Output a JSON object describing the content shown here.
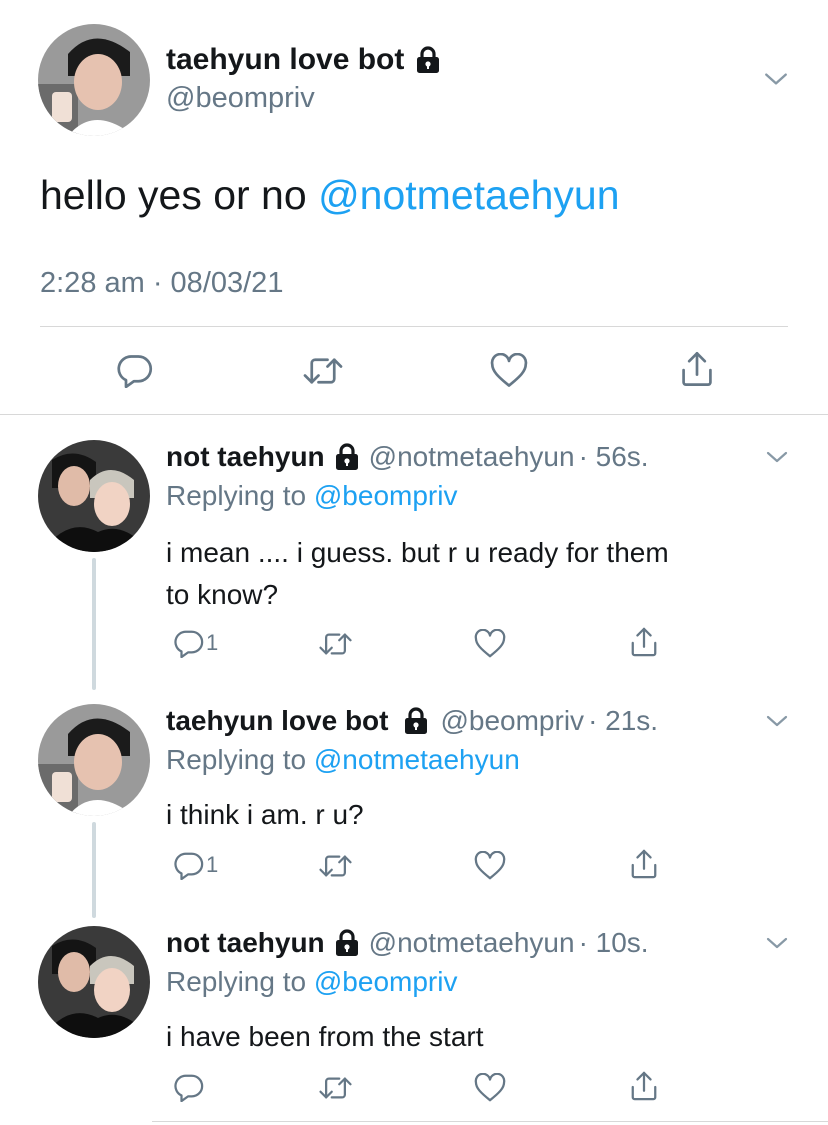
{
  "main_tweet": {
    "display_name": "taehyun love bot",
    "handle": "@beompriv",
    "text": "hello yes or no ",
    "mention": "@notmetaehyun",
    "timestamp": "2:28 am · 08/03/21"
  },
  "replies": [
    {
      "display_name": "not taehyun",
      "handle": "@notmetaehyun",
      "time": "· 56s.",
      "replying_label": "Replying to ",
      "replying_to": "@beompriv",
      "text_line1": "i mean .... i guess. but r u ready for them",
      "text_line2": "to know?",
      "reply_count": "1"
    },
    {
      "display_name": "taehyun love bot",
      "handle": "@beompriv",
      "time": "· 21s.",
      "replying_label": "Replying to ",
      "replying_to": "@notmetaehyun",
      "text_line1": "i think i am. r u?",
      "reply_count": "1"
    },
    {
      "display_name": "not taehyun",
      "handle": "@notmetaehyun",
      "time": "· 10s.",
      "replying_label": "Replying to ",
      "replying_to": "@beompriv",
      "text_line1": "i have been from the start",
      "reply_count": ""
    }
  ],
  "icons": [
    "lock-icon",
    "chevron-down-icon",
    "reply-icon",
    "retweet-icon",
    "like-icon",
    "share-icon"
  ],
  "colors": {
    "link": "#1da1f2",
    "secondary": "#657786",
    "text": "#14171a",
    "icon": "#657786"
  }
}
